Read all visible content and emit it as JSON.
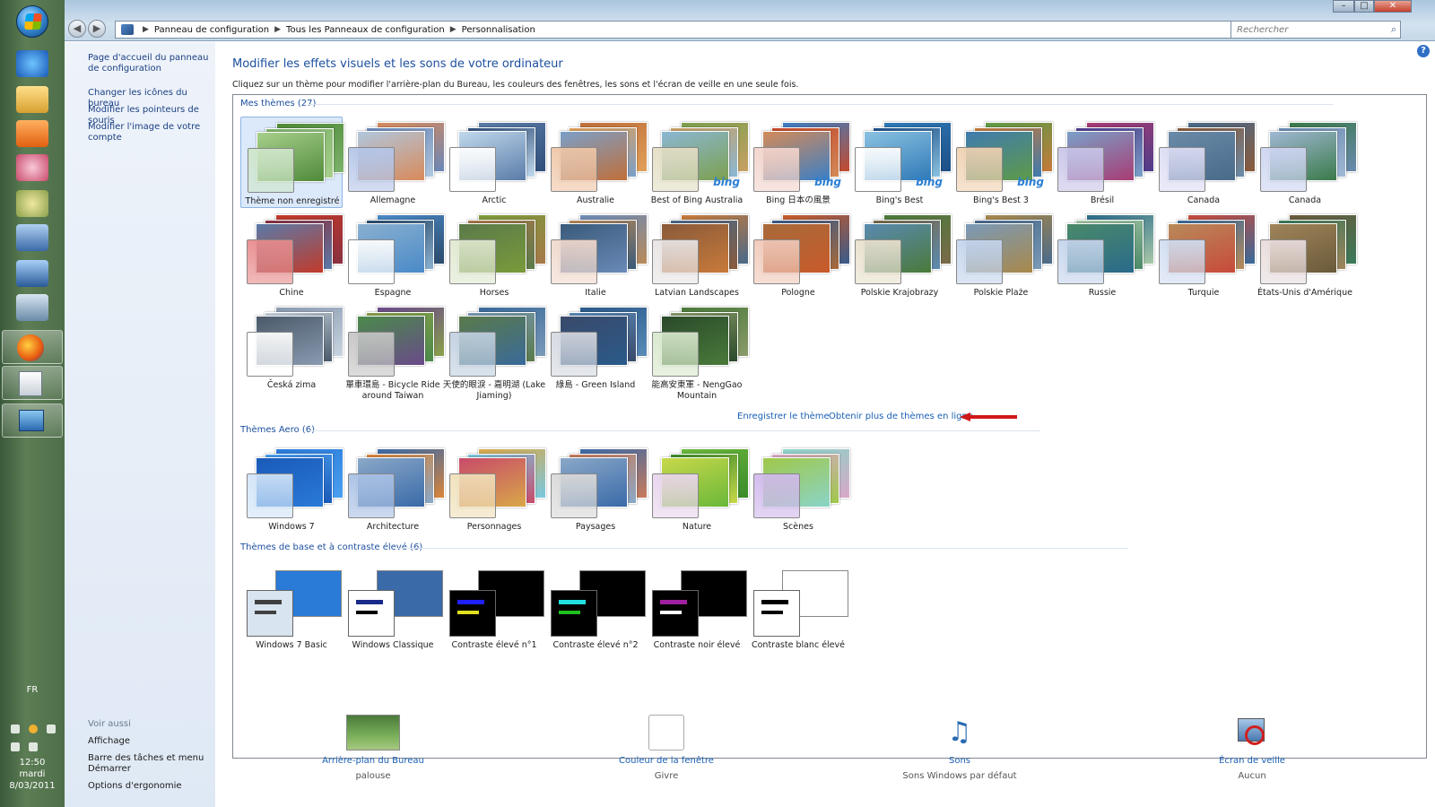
{
  "address": {
    "crumbs": [
      "Panneau de configuration",
      "Tous les Panneaux de configuration",
      "Personnalisation"
    ],
    "search_placeholder": "Rechercher"
  },
  "taskbar": {
    "language": "FR",
    "time": "12:50",
    "day": "mardi",
    "date": "8/03/2011"
  },
  "left_nav": {
    "links": [
      "Page d'accueil du panneau de configuration",
      "Changer les icônes du bureau",
      "Modifier les pointeurs de souris",
      "Modifier l'image de votre compte"
    ],
    "see_also_title": "Voir aussi",
    "see_also": [
      "Affichage",
      "Barre des tâches et menu Démarrer",
      "Options d'ergonomie"
    ]
  },
  "main": {
    "title": "Modifier les effets visuels et les sons de votre ordinateur",
    "description": "Cliquez sur un thème pour modifier l'arrière-plan du Bureau, les couleurs des fenêtres, les sons et l'écran de veille en une seule fois."
  },
  "groups": {
    "my_themes": {
      "title": "Mes thèmes (27)",
      "items": [
        {
          "name": "Thème non enregistré",
          "colors": [
            "#4f8a3a",
            "#7cb26a",
            "#a7cf8b"
          ],
          "swatch": "#cfe6c9"
        },
        {
          "name": "Allemagne",
          "colors": [
            "#d98a5b",
            "#6a87b8",
            "#b0c7dd"
          ],
          "swatch": "#b4c5e8"
        },
        {
          "name": "Arctic",
          "colors": [
            "#5a7ca8",
            "#2f4f7a",
            "#c0d8ec"
          ],
          "swatch": "#ffffff"
        },
        {
          "name": "Australie",
          "colors": [
            "#c06f3a",
            "#e0a05a",
            "#7b9fc8"
          ],
          "swatch": "#efc5a5"
        },
        {
          "name": "Best of Bing Australia",
          "colors": [
            "#7da04e",
            "#c8a064",
            "#8ab7d4"
          ],
          "swatch": "#e3ddc2",
          "bing": "bing"
        },
        {
          "name": "Bing 日本の風景",
          "colors": [
            "#3b7fc6",
            "#c44a2e",
            "#d48a58"
          ],
          "swatch": "#f2d4cc",
          "bing": "bing"
        },
        {
          "name": "Bing's Best",
          "colors": [
            "#2f7ab8",
            "#1d4f86",
            "#8ac1e0"
          ],
          "swatch": "#ffffff",
          "bing": "bing"
        },
        {
          "name": "Bing's Best 3",
          "colors": [
            "#5e9a46",
            "#c47a3a",
            "#3f7bb0"
          ],
          "swatch": "#efd1b0",
          "bing": "bing"
        },
        {
          "name": "Brésil",
          "colors": [
            "#a83c74",
            "#4d3c8a",
            "#7aa0c8"
          ],
          "swatch": "#c8c4e8"
        },
        {
          "name": "Canada",
          "colors": [
            "#4a6a8a",
            "#8a5a3a",
            "#6a8aa8"
          ],
          "swatch": "#dcdcf4"
        },
        {
          "name": "Canada",
          "colors": [
            "#3a7a4a",
            "#6a8ab0",
            "#a0b8d4"
          ],
          "swatch": "#ccd4f0"
        },
        {
          "name": "Chine",
          "colors": [
            "#c23a2a",
            "#8a3040",
            "#5a7aa8"
          ],
          "swatch": "#e88a8a"
        },
        {
          "name": "Espagne",
          "colors": [
            "#4a8ac8",
            "#2a4a6a",
            "#8ab0d0"
          ],
          "swatch": "#ffffff"
        },
        {
          "name": "Horses",
          "colors": [
            "#7a9a3a",
            "#a8784a",
            "#5a7a4a"
          ],
          "swatch": "#dfe8cf"
        },
        {
          "name": "Italie",
          "colors": [
            "#6a8ab8",
            "#b88a5a",
            "#3a5a7a"
          ],
          "swatch": "#f0d8cc"
        },
        {
          "name": "Latvian Landscapes",
          "colors": [
            "#c87a3a",
            "#4a6a8a",
            "#8a5a3a"
          ],
          "swatch": "#e8e4e4"
        },
        {
          "name": "Pologne",
          "colors": [
            "#c85a2a",
            "#3a5a8a",
            "#a86a3a"
          ],
          "swatch": "#f0c8b8"
        },
        {
          "name": "Polskie Krajobrazy",
          "colors": [
            "#4a7a3a",
            "#7a6a4a",
            "#5a8ab0"
          ],
          "swatch": "#e8e0cc"
        },
        {
          "name": "Polskie Plaże",
          "colors": [
            "#a8884a",
            "#4a6a8a",
            "#7a9ab8"
          ],
          "swatch": "#c4d4ec"
        },
        {
          "name": "Russie",
          "colors": [
            "#2a6a8a",
            "#a8c8a8",
            "#4a8a6a"
          ],
          "swatch": "#c4d4ec"
        },
        {
          "name": "Turquie",
          "colors": [
            "#c84a3a",
            "#3a6a9a",
            "#b88a5a"
          ],
          "swatch": "#d0dcf0"
        },
        {
          "name": "États-Unis d'Amérique",
          "colors": [
            "#6a5a3a",
            "#3a7a5a",
            "#a0845a"
          ],
          "swatch": "#e8dcdc"
        },
        {
          "name": "Česká zima",
          "colors": [
            "#8a9ab0",
            "#c8d4e0",
            "#4a5a6a"
          ],
          "swatch": "#ffffff"
        },
        {
          "name": "單車環島 - Bicycle Ride around Taiwan",
          "colors": [
            "#6a4a8a",
            "#8aa04a",
            "#4a8a4a"
          ],
          "swatch": "#c4c4c4"
        },
        {
          "name": "天使的眼淚 - 嘉明湖 (Lake Jiaming)",
          "colors": [
            "#3a6a9a",
            "#7a9ab8",
            "#5a7a4a"
          ],
          "swatch": "#c0d0e0"
        },
        {
          "name": "綠島 - Green Island",
          "colors": [
            "#2a5a8a",
            "#5a8ab8",
            "#3a4a6a"
          ],
          "swatch": "#d4d8e0"
        },
        {
          "name": "能高安東軍 - NengGao Mountain",
          "colors": [
            "#4a7a3a",
            "#8a9a6a",
            "#2a4a2a"
          ],
          "swatch": "#d8e8cc"
        }
      ]
    },
    "actions": {
      "save": "Enregistrer le thème",
      "more_online": "Obtenir plus de thèmes en ligne"
    },
    "aero_themes": {
      "title": "Thèmes Aero (6)",
      "items": [
        {
          "name": "Windows 7",
          "colors": [
            "#2a7ad8",
            "#4aa0f0",
            "#1a5ab8"
          ],
          "swatch": "#d0e4f8"
        },
        {
          "name": "Architecture",
          "colors": [
            "#3a6aa8",
            "#d8843a",
            "#8aa8c8"
          ],
          "swatch": "#a8c0e4"
        },
        {
          "name": "Personnages",
          "colors": [
            "#d8a848",
            "#7ac8e0",
            "#c84a6a"
          ],
          "swatch": "#f0e0b8"
        },
        {
          "name": "Paysages",
          "colors": [
            "#3a6aa8",
            "#c87a5a",
            "#8aa8c8"
          ],
          "swatch": "#d8d8d8"
        },
        {
          "name": "Nature",
          "colors": [
            "#6ab83a",
            "#3a8a2a",
            "#c8d84a"
          ],
          "swatch": "#e8d4ec"
        },
        {
          "name": "Scènes",
          "colors": [
            "#8ad4c8",
            "#d8a8c8",
            "#a0c84a"
          ],
          "swatch": "#d0b8ec"
        }
      ]
    },
    "basic_themes": {
      "title": "Thèmes de base et à contraste élevé (6)",
      "items": [
        {
          "name": "Windows 7 Basic",
          "bg": "#2a7ad8",
          "box": "#d8e4f0",
          "bar1": "#404040",
          "bar2": "#404040"
        },
        {
          "name": "Windows Classique",
          "bg": "#3a6aa8",
          "box": "#ffffff",
          "bar1": "#1a2a8a",
          "bar2": "#000000"
        },
        {
          "name": "Contraste élevé n°1",
          "bg": "#000000",
          "box": "#000000",
          "bar1": "#2020ff",
          "bar2": "#e0e020"
        },
        {
          "name": "Contraste élevé n°2",
          "bg": "#000000",
          "box": "#000000",
          "bar1": "#20e0e0",
          "bar2": "#20c020"
        },
        {
          "name": "Contraste noir élevé",
          "bg": "#000000",
          "box": "#000000",
          "bar1": "#a020a0",
          "bar2": "#ffffff"
        },
        {
          "name": "Contraste blanc élevé",
          "bg": "#ffffff",
          "box": "#ffffff",
          "bar1": "#000000",
          "bar2": "#000000"
        }
      ]
    }
  },
  "bottom": {
    "wallpaper": {
      "label": "Arrière-plan du Bureau",
      "value": "palouse"
    },
    "color": {
      "label": "Couleur de la fenêtre",
      "value": "Givre"
    },
    "sounds": {
      "label": "Sons",
      "value": "Sons Windows par défaut"
    },
    "screensaver": {
      "label": "Écran de veille",
      "value": "Aucun"
    }
  },
  "accent_color": "#1c4f9f",
  "annotation_color": "#d01818"
}
